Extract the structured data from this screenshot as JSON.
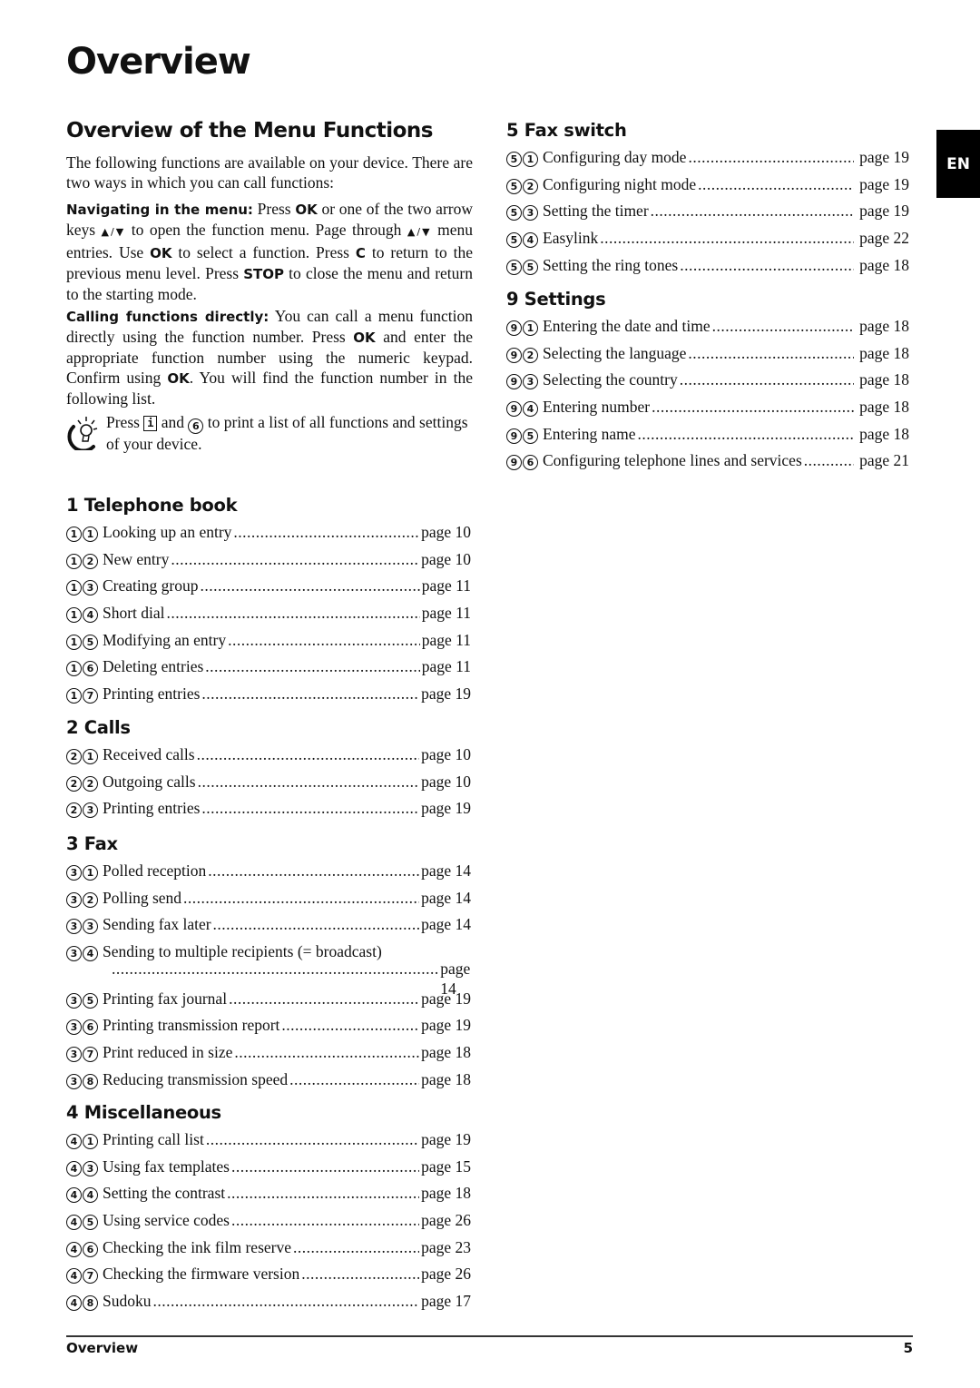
{
  "page_title": "Overview",
  "section_title": "Overview of the Menu Functions",
  "intro": {
    "p1": "The following functions are available on your device. There are two ways in which you can call functions:",
    "navigating": {
      "lead": "Navigating in the menu:",
      "t1": " Press ",
      "k1": "OK",
      "t2": " or one of the two arrow keys ",
      "arrows": "▲/▼",
      "t3": " to open the function menu. Page through ",
      "t4": " menu entries. Use ",
      "k2": "OK",
      "t5": " to select a function. Press ",
      "k3": "C",
      "t6": " to return to the previous menu level. Press ",
      "k4": "STOP",
      "t7": " to close the menu and return to the starting mode."
    },
    "calling": {
      "lead": "Calling functions directly:",
      "t1": " You can call a menu function directly using the function number. Press ",
      "k1": "OK",
      "t2": " and enter the appropriate function number using the numeric keypad. Confirm using ",
      "k2": "OK",
      "t3": ". You will find the function number in the following list."
    },
    "tip": {
      "icon": "lightbulb-tip-icon",
      "t1": "Press ",
      "key_info": "i",
      "t2": " and ",
      "key_num": "6",
      "t3": " to print a list of all functions and settings of your device."
    }
  },
  "groups": {
    "g1": {
      "title": "1 Telephone book",
      "entries": [
        {
          "code": [
            "1",
            "1"
          ],
          "label": "Looking up an entry",
          "page": "page 10"
        },
        {
          "code": [
            "1",
            "2"
          ],
          "label": "New entry",
          "page": "page 10"
        },
        {
          "code": [
            "1",
            "3"
          ],
          "label": "Creating group",
          "page": "page 11"
        },
        {
          "code": [
            "1",
            "4"
          ],
          "label": "Short dial",
          "page": "page 11"
        },
        {
          "code": [
            "1",
            "5"
          ],
          "label": "Modifying an entry",
          "page": "page 11"
        },
        {
          "code": [
            "1",
            "6"
          ],
          "label": "Deleting entries",
          "page": "page 11"
        },
        {
          "code": [
            "1",
            "7"
          ],
          "label": "Printing entries",
          "page": "page 19"
        }
      ]
    },
    "g2": {
      "title": "2 Calls",
      "entries": [
        {
          "code": [
            "2",
            "1"
          ],
          "label": "Received calls",
          "page": "page 10"
        },
        {
          "code": [
            "2",
            "2"
          ],
          "label": "Outgoing calls",
          "page": "page 10"
        },
        {
          "code": [
            "2",
            "3"
          ],
          "label": "Printing entries",
          "page": "page 19"
        }
      ]
    },
    "g3": {
      "title": "3 Fax",
      "entries": [
        {
          "code": [
            "3",
            "1"
          ],
          "label": "Polled reception",
          "page": "page 14"
        },
        {
          "code": [
            "3",
            "2"
          ],
          "label": "Polling send",
          "page": "page 14"
        },
        {
          "code": [
            "3",
            "3"
          ],
          "label": "Sending fax later",
          "page": "page 14"
        },
        {
          "code": [
            "3",
            "4"
          ],
          "label": "Sending to multiple recipients (= broadcast)",
          "page": "page 14"
        },
        {
          "code": [
            "3",
            "5"
          ],
          "label": "Printing fax journal",
          "page": "page 19"
        },
        {
          "code": [
            "3",
            "6"
          ],
          "label": "Printing transmission report",
          "page": "page 19"
        },
        {
          "code": [
            "3",
            "7"
          ],
          "label": "Print reduced in size",
          "page": "page 18"
        },
        {
          "code": [
            "3",
            "8"
          ],
          "label": "Reducing transmission speed",
          "page": "page 18"
        }
      ]
    },
    "g4": {
      "title": "4 Miscellaneous",
      "entries": [
        {
          "code": [
            "4",
            "1"
          ],
          "label": "Printing call list",
          "page": "page 19"
        },
        {
          "code": [
            "4",
            "3"
          ],
          "label": "Using fax templates",
          "page": "page 15"
        },
        {
          "code": [
            "4",
            "4"
          ],
          "label": "Setting the contrast",
          "page": "page 18"
        },
        {
          "code": [
            "4",
            "5"
          ],
          "label": "Using service codes",
          "page": "page 26"
        },
        {
          "code": [
            "4",
            "6"
          ],
          "label": "Checking the ink film reserve",
          "page": "page 23"
        },
        {
          "code": [
            "4",
            "7"
          ],
          "label": "Checking the firmware version",
          "page": "page 26"
        },
        {
          "code": [
            "4",
            "8"
          ],
          "label": "Sudoku",
          "page": "page 17"
        }
      ]
    },
    "g5": {
      "title": "5 Fax switch",
      "entries": [
        {
          "code": [
            "5",
            "1"
          ],
          "label": "Configuring day mode",
          "page": "page 19"
        },
        {
          "code": [
            "5",
            "2"
          ],
          "label": "Configuring night mode",
          "page": "page 19"
        },
        {
          "code": [
            "5",
            "3"
          ],
          "label": "Setting the timer",
          "page": "page 19"
        },
        {
          "code": [
            "5",
            "4"
          ],
          "label": "Easylink",
          "page": "page 22"
        },
        {
          "code": [
            "5",
            "5"
          ],
          "label": "Setting the ring tones",
          "page": "page 18"
        }
      ]
    },
    "g9": {
      "title": "9 Settings",
      "entries": [
        {
          "code": [
            "9",
            "1"
          ],
          "label": "Entering the date and time",
          "page": "page 18"
        },
        {
          "code": [
            "9",
            "2"
          ],
          "label": "Selecting the language",
          "page": "page 18"
        },
        {
          "code": [
            "9",
            "3"
          ],
          "label": "Selecting the country",
          "page": "page 18"
        },
        {
          "code": [
            "9",
            "4"
          ],
          "label": "Entering number",
          "page": "page 18"
        },
        {
          "code": [
            "9",
            "5"
          ],
          "label": "Entering name",
          "page": "page 18"
        },
        {
          "code": [
            "9",
            "6"
          ],
          "label": "Configuring telephone lines and services",
          "page": "page 21"
        }
      ]
    }
  },
  "language_tab": "EN",
  "footer": {
    "label": "Overview",
    "page_number": "5"
  }
}
